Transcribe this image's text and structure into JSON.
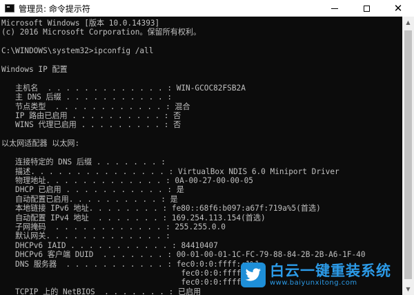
{
  "window": {
    "title": "管理员: 命令提示符",
    "icon": "cmd-icon"
  },
  "controls": {
    "minimize": "minimize-icon",
    "maximize": "maximize-icon",
    "close": "close-icon",
    "close_glyph": "✕"
  },
  "console_lines": [
    "Microsoft Windows [版本 10.0.14393]",
    "(c) 2016 Microsoft Corporation。保留所有权利。",
    "",
    "C:\\WINDOWS\\system32>ipconfig /all",
    "",
    "Windows IP 配置",
    "",
    "   主机名  . . . . . . . . . . . . . : WIN-GCOC82FSB2A",
    "   主 DNS 后缀 . . . . . . . . . . . :",
    "   节点类型  . . . . . . . . . . . . : 混合",
    "   IP 路由已启用 . . . . . . . . . . : 否",
    "   WINS 代理已启用 . . . . . . . . . : 否",
    "",
    "以太网适配器 以太网:",
    "",
    "   连接特定的 DNS 后缀 . . . . . . . :",
    "   描述. . . . . . . . . . . . . . . : VirtualBox NDIS 6.0 Miniport Driver",
    "   物理地址. . . . . . . . . . . . . : 0A-00-27-00-00-05",
    "   DHCP 已启用 . . . . . . . . . . . : 是",
    "   自动配置已启用. . . . . . . . . . : 是",
    "   本地链接 IPv6 地址. . . . . . . . : fe80::68f6:b097:a67f:719a%5(首选)",
    "   自动配置 IPv4 地址  . . . . . . . : 169.254.113.154(首选)",
    "   子网掩码  . . . . . . . . . . . . : 255.255.0.0",
    "   默认网关. . . . . . . . . . . . . :",
    "   DHCPv6 IAID . . . . . . . . . . . : 84410407",
    "   DHCPv6 客户端 DUID  . . . . . . . : 00-01-00-01-1C-FC-79-88-84-2B-2B-A6-1F-40",
    "   DNS 服务器  . . . . . . . . . . . : fec0:0:0:ffff::1%1",
    "                                       fec0:0:0:ffff::2%1",
    "                                       fec0:0:0:ffff::3%1",
    "   TCPIP 上的 NetBIOS  . . . . . . . : 已启用"
  ],
  "watermark": {
    "brand": "白云一键重装系统",
    "url": "www.baiyunxitong.com",
    "logo": "bird-logo-icon"
  },
  "colors": {
    "console_bg": "#0c0c0c",
    "console_fg": "#c0c0c0",
    "titlebar_bg": "#ffffff",
    "brand": "#2c9be8"
  }
}
